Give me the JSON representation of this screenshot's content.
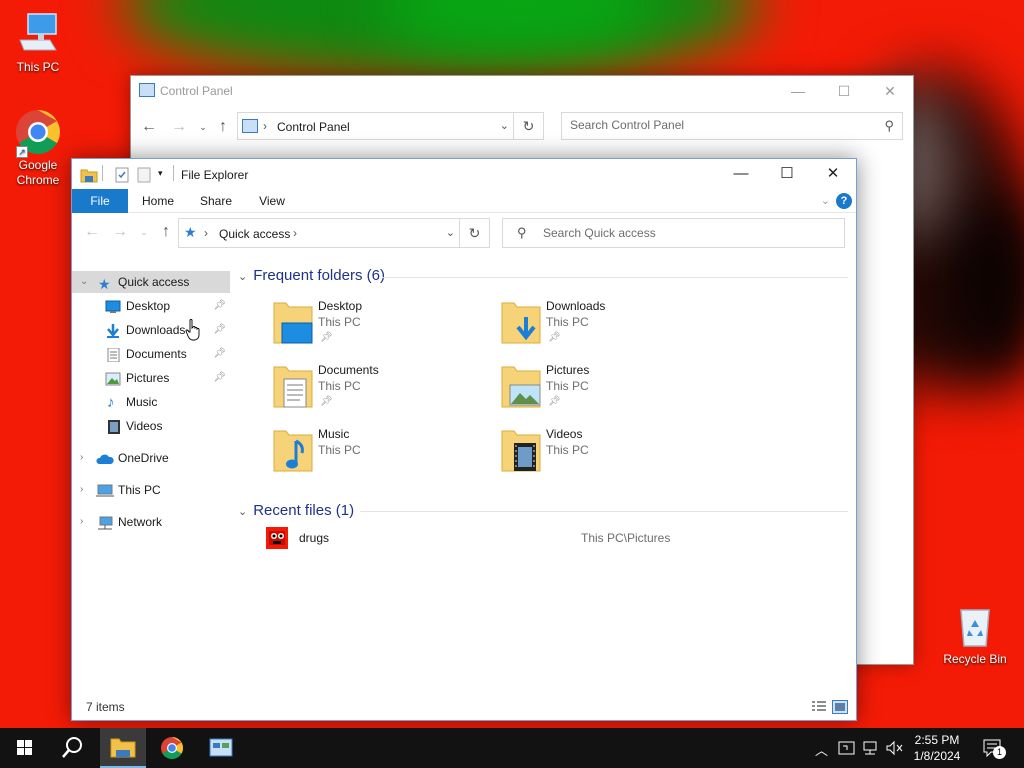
{
  "desktop": {
    "icons": [
      {
        "label": "This PC"
      },
      {
        "label": "Google Chrome"
      },
      {
        "label": "Recycle Bin"
      }
    ]
  },
  "control_panel": {
    "title": "Control Panel",
    "breadcrumb": "Control Panel",
    "search_placeholder": "Search Control Panel"
  },
  "explorer": {
    "title": "File Explorer",
    "ribbon_tabs": [
      "File",
      "Home",
      "Share",
      "View"
    ],
    "breadcrumb": "Quick access",
    "search_placeholder": "Search Quick access",
    "sidebar": {
      "quick_access": "Quick access",
      "pinned": [
        {
          "label": "Desktop",
          "icon": "desktop-icon",
          "pinned": true
        },
        {
          "label": "Downloads",
          "icon": "downloads-icon",
          "pinned": true
        },
        {
          "label": "Documents",
          "icon": "documents-icon",
          "pinned": true
        },
        {
          "label": "Pictures",
          "icon": "pictures-icon",
          "pinned": true
        },
        {
          "label": "Music",
          "icon": "music-icon",
          "pinned": false
        },
        {
          "label": "Videos",
          "icon": "videos-icon",
          "pinned": false
        }
      ],
      "onedrive": "OneDrive",
      "this_pc": "This PC",
      "network": "Network"
    },
    "frequent_header": "Frequent folders (6)",
    "frequent_folders": [
      {
        "name": "Desktop",
        "location": "This PC",
        "pinned": true
      },
      {
        "name": "Downloads",
        "location": "This PC",
        "pinned": true
      },
      {
        "name": "Documents",
        "location": "This PC",
        "pinned": true
      },
      {
        "name": "Pictures",
        "location": "This PC",
        "pinned": true
      },
      {
        "name": "Music",
        "location": "This PC",
        "pinned": false
      },
      {
        "name": "Videos",
        "location": "This PC",
        "pinned": false
      }
    ],
    "recent_header": "Recent files (1)",
    "recent_files": [
      {
        "name": "drugs",
        "path": "This PC\\Pictures"
      }
    ],
    "status": "7 items"
  },
  "taskbar": {
    "time": "2:55 PM",
    "date": "1/8/2024",
    "notification_count": "1"
  },
  "colors": {
    "wallpaper": "#f41b06",
    "file_tab": "#1979ca",
    "section_header": "#1e3287",
    "taskbar": "#121212"
  }
}
